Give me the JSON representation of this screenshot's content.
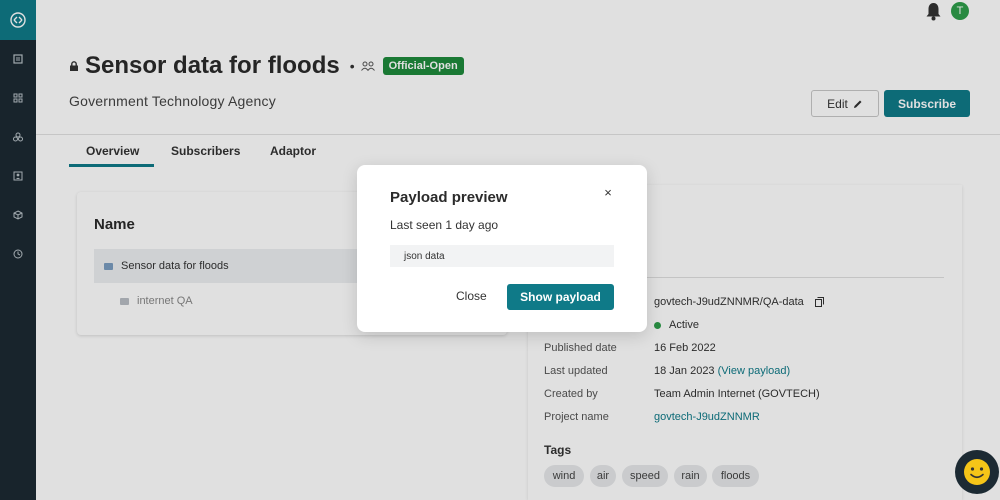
{
  "colors": {
    "accent": "#0f7a88",
    "badge_green": "#1e8a3c",
    "sidebar_bg": "#1c2a33",
    "status_active": "#2e9e4a"
  },
  "sidebar": {
    "logo_icon": "share-icon",
    "items": [
      {
        "icon": "document-icon"
      },
      {
        "icon": "grid-icon"
      },
      {
        "icon": "cluster-icon"
      },
      {
        "icon": "contact-card-icon"
      },
      {
        "icon": "cube-icon"
      },
      {
        "icon": "clock-icon"
      }
    ]
  },
  "topbar": {
    "notification_icon": "bell-icon",
    "avatar_initial": "T"
  },
  "header": {
    "title": "Sensor data for floods",
    "separator": "•",
    "badge": "Official-Open",
    "subtitle": "Government Technology Agency",
    "edit_label": "Edit",
    "subscribe_label": "Subscribe"
  },
  "tabs": [
    {
      "label": "Overview",
      "active": true
    },
    {
      "label": "Subscribers",
      "active": false
    },
    {
      "label": "Adaptor",
      "active": false
    }
  ],
  "name_card": {
    "title": "Name",
    "items": [
      {
        "label": "Sensor data for floods",
        "selected": true
      },
      {
        "label": "internet QA",
        "selected": false
      }
    ]
  },
  "details": {
    "rows": [
      {
        "label": "",
        "value": "govtech-J9udZNNMR/QA-data"
      },
      {
        "label": "",
        "value": "Active"
      },
      {
        "label": "Published date",
        "value": "16 Feb 2022"
      },
      {
        "label": "Last updated",
        "value": "18 Jan 2023",
        "link": "(View payload)"
      },
      {
        "label": "Created by",
        "value": "Team Admin Internet (GOVTECH)"
      },
      {
        "label": "Project name",
        "value": "govtech-J9udZNNMR"
      }
    ],
    "tags_title": "Tags",
    "tags": [
      "wind",
      "air",
      "speed",
      "rain",
      "floods"
    ]
  },
  "modal": {
    "title": "Payload preview",
    "close_symbol": "×",
    "last_seen": "Last seen 1 day ago",
    "payload_text": "json data",
    "close_label": "Close",
    "show_label": "Show payload"
  }
}
